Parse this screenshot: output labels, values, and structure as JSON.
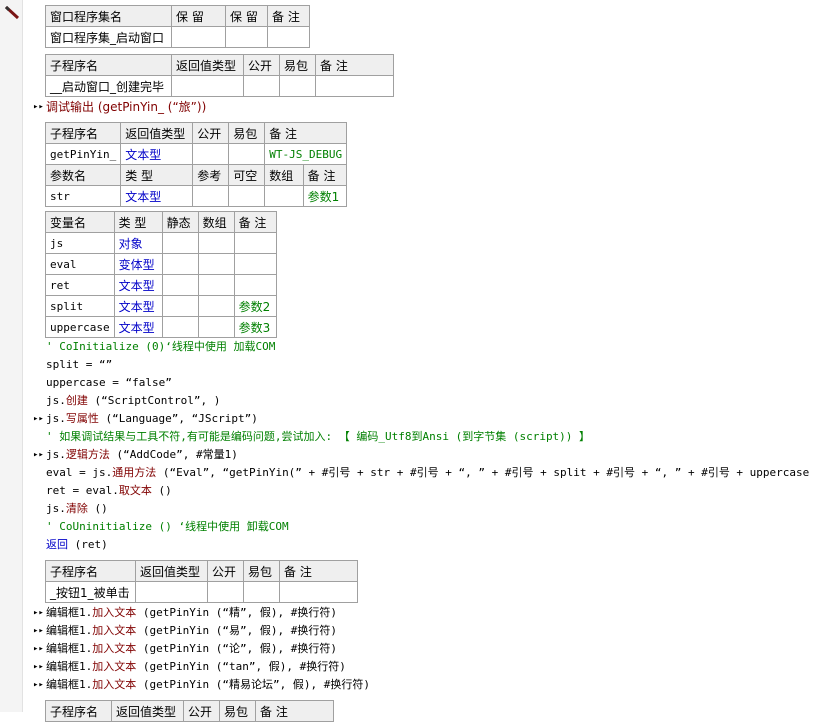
{
  "t1": {
    "headers": [
      "窗口程序集名",
      "保 留",
      "保 留",
      "备 注"
    ],
    "row": [
      "窗口程序集_启动窗口",
      "",
      "",
      ""
    ]
  },
  "t2": {
    "headers": [
      "子程序名",
      "返回值类型",
      "公开",
      "易包",
      "备 注"
    ],
    "row": [
      "__启动窗口_创建完毕",
      "",
      "",
      "",
      ""
    ]
  },
  "line_debug": "调试输出 (getPinYin_ (“旅”))",
  "t3": {
    "headers": [
      "子程序名",
      "返回值类型",
      "公开",
      "易包",
      "备 注"
    ],
    "row": [
      "getPinYin_",
      "文本型",
      "",
      "",
      "WT-JS_DEBUG"
    ],
    "param_headers": [
      "参数名",
      "类 型",
      "参考",
      "可空",
      "数组",
      "备 注"
    ],
    "param_row": [
      "str",
      "文本型",
      "",
      "",
      "",
      "参数1"
    ]
  },
  "t4": {
    "headers": [
      "变量名",
      "类 型",
      "静态",
      "数组",
      "备 注"
    ],
    "rows": [
      [
        "js",
        "对象",
        "",
        "",
        ""
      ],
      [
        "eval",
        "变体型",
        "",
        "",
        ""
      ],
      [
        "ret",
        "文本型",
        "",
        "",
        ""
      ],
      [
        "split",
        "文本型",
        "",
        "",
        "参数2"
      ],
      [
        "uppercase",
        "文本型",
        "",
        "",
        "参数3"
      ]
    ]
  },
  "code": {
    "l1": "' CoInitialize (0)‘线程中使用 加载COM",
    "l2": "split = “”",
    "l3": "uppercase = “false”",
    "l4a": "js.",
    "l4b": "创建",
    "l4c": " (“ScriptControl”, )",
    "l5a": "js.",
    "l5b": "写属性",
    "l5c": " (“Language”, “JScript”)",
    "l6": "' 如果调试结果与工具不符,有可能是编码问题,尝试加入: 【 编码_Utf8到Ansi (到字节集 (script)) 】",
    "l7a": "js.",
    "l7b": "逻辑方法",
    "l7c": " (“AddCode”, #常量1)",
    "l8a": "eval = js.",
    "l8b": "通用方法",
    "l8c": " (“Eval”, “getPinYin(” + #引号 + str + #引号 + “, ” + #引号 + split + #引号 + “, ” + #引号 + uppercase",
    "l9a": "ret = eval.",
    "l9b": "取文本",
    "l9c": " ()",
    "l10a": "js.",
    "l10b": "清除",
    "l10c": " ()",
    "l11": "' CoUninitialize () ‘线程中使用 卸载COM",
    "l12a": "返回",
    "l12b": " (ret)"
  },
  "t5": {
    "headers": [
      "子程序名",
      "返回值类型",
      "公开",
      "易包",
      "备 注"
    ],
    "row": [
      "_按钮1_被单击",
      "",
      "",
      "",
      ""
    ]
  },
  "calls": [
    {
      "obj": "编辑框1.",
      "method": "加入文本",
      "args": " (getPinYin (“精”, 假), #换行符)"
    },
    {
      "obj": "编辑框1.",
      "method": "加入文本",
      "args": " (getPinYin (“易”, 假), #换行符)"
    },
    {
      "obj": "编辑框1.",
      "method": "加入文本",
      "args": " (getPinYin (“论”, 假), #换行符)"
    },
    {
      "obj": "编辑框1.",
      "method": "加入文本",
      "args": " (getPinYin (“tan”, 假), #换行符)"
    },
    {
      "obj": "编辑框1.",
      "method": "加入文本",
      "args": " (getPinYin (“精易论坛”, 假), #换行符)"
    }
  ],
  "t6": {
    "headers": [
      "子程序名",
      "返回值类型",
      "公开",
      "易包",
      "备 注"
    ]
  },
  "colors": {
    "blue": "#0000c8",
    "green": "#008000",
    "maroon": "#800000",
    "header_bg": "#efefef"
  }
}
